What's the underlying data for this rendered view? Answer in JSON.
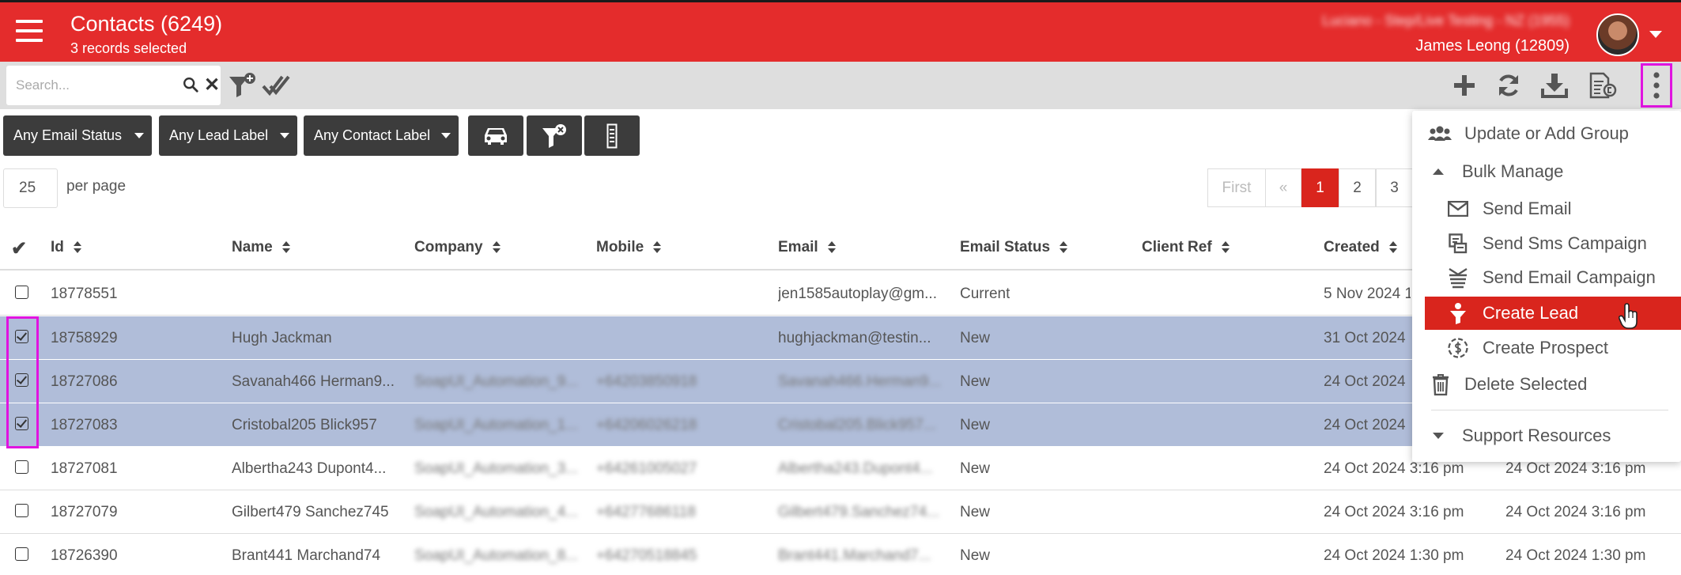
{
  "header": {
    "title": "Contacts (6249)",
    "subtitle": "3 records selected",
    "account": "Luciano - Step/Live Testing - NZ (1955)",
    "user": "James Leong (12809)"
  },
  "toolbar": {
    "search_placeholder": "Search..."
  },
  "filters": {
    "email_status": "Any Email Status",
    "lead_label": "Any Lead Label",
    "contact_label": "Any Contact Label"
  },
  "paging": {
    "per_page_value": "25",
    "per_page_label": "per page",
    "first": "First",
    "prev": "«",
    "pages": [
      "1",
      "2",
      "3"
    ]
  },
  "table": {
    "headers": {
      "id": "Id",
      "name": "Name",
      "company": "Company",
      "mobile": "Mobile",
      "email": "Email",
      "email_status": "Email Status",
      "client_ref": "Client Ref",
      "created": "Created"
    },
    "rows": [
      {
        "id": "18778551",
        "name": "",
        "company": "",
        "mobile": "",
        "email": "jen1585autoplay@gm...",
        "status": "Current",
        "created": "5 Nov 2024 1",
        "modified": ""
      },
      {
        "id": "18758929",
        "name": "Hugh Jackman",
        "company": "",
        "mobile": "",
        "email": "hughjackman@testin...",
        "status": "New",
        "created": "31 Oct 2024",
        "modified": ""
      },
      {
        "id": "18727086",
        "name": "Savanah466 Herman9...",
        "company": "SoapUI_Automation_9...",
        "mobile": "+64203850918",
        "email": "Savanah466.Herman9...",
        "status": "New",
        "created": "24 Oct 2024",
        "modified": ""
      },
      {
        "id": "18727083",
        "name": "Cristobal205 Blick957",
        "company": "SoapUI_Automation_1...",
        "mobile": "+64206026218",
        "email": "Cristobal205.Blick957...",
        "status": "New",
        "created": "24 Oct 2024",
        "modified": ""
      },
      {
        "id": "18727081",
        "name": "Albertha243 Dupont4...",
        "company": "SoapUI_Automation_3...",
        "mobile": "+64261005027",
        "email": "Albertha243.Dupont4...",
        "status": "New",
        "created": "24 Oct 2024 3:16 pm",
        "modified": "24 Oct 2024 3:16 pm"
      },
      {
        "id": "18727079",
        "name": "Gilbert479 Sanchez745",
        "company": "SoapUI_Automation_4...",
        "mobile": "+64277686118",
        "email": "Gilbert479.Sanchez74...",
        "status": "New",
        "created": "24 Oct 2024 3:16 pm",
        "modified": "24 Oct 2024 3:16 pm"
      },
      {
        "id": "18726390",
        "name": "Brant441 Marchand74",
        "company": "SoapUI_Automation_8...",
        "mobile": "+64270518845",
        "email": "Brant441.Marchand7...",
        "status": "New",
        "created": "24 Oct 2024 1:30 pm",
        "modified": "24 Oct 2024 1:30 pm"
      }
    ]
  },
  "menu": {
    "update_group": "Update or Add Group",
    "bulk_manage": "Bulk Manage",
    "send_email": "Send Email",
    "send_sms": "Send Sms Campaign",
    "send_email_campaign": "Send Email Campaign",
    "create_lead": "Create Lead",
    "create_prospect": "Create Prospect",
    "delete_selected": "Delete Selected",
    "support_resources": "Support Resources"
  },
  "colors": {
    "brand_red": "#e42c2c",
    "selected_row": "#b0bdd9",
    "highlight": "#e014e0"
  }
}
